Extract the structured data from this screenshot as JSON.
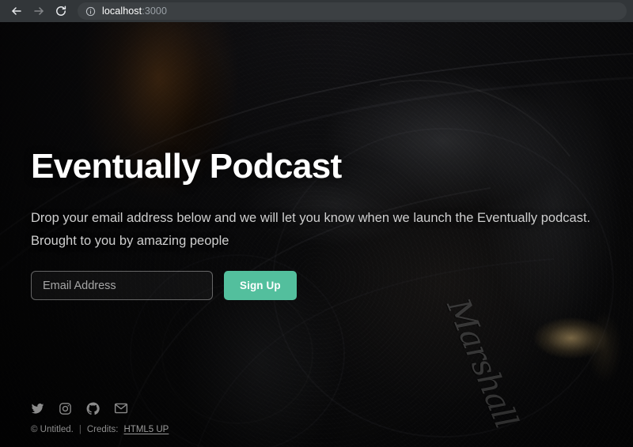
{
  "browser": {
    "back_icon": "arrow-left-icon",
    "forward_icon": "arrow-right-icon",
    "reload_icon": "reload-icon",
    "info_icon": "info-circle-icon",
    "url_host": "localhost",
    "url_port": ":3000",
    "url_full": "localhost:3000",
    "toolbar_color": "#323639",
    "omnibox_color": "#3c4043"
  },
  "hero": {
    "title": "Eventually Podcast",
    "subtitle": "Drop your email address below and we will let you know when we launch the Eventually podcast. Brought to you by amazing people",
    "background_alt": "dark Marshall headphones photograph",
    "brand_mark": "Marshall"
  },
  "form": {
    "email_placeholder": "Email Address",
    "email_value": "",
    "submit_label": "Sign Up",
    "accent_color": "#53bf9d"
  },
  "footer": {
    "social": [
      {
        "name": "twitter-icon",
        "label": "Twitter"
      },
      {
        "name": "instagram-icon",
        "label": "Instagram"
      },
      {
        "name": "github-icon",
        "label": "GitHub"
      },
      {
        "name": "email-icon",
        "label": "Email"
      }
    ],
    "copyright": "© Untitled.",
    "separator": "|",
    "credits_prefix": "Credits:",
    "credits_link": "HTML5 UP"
  }
}
